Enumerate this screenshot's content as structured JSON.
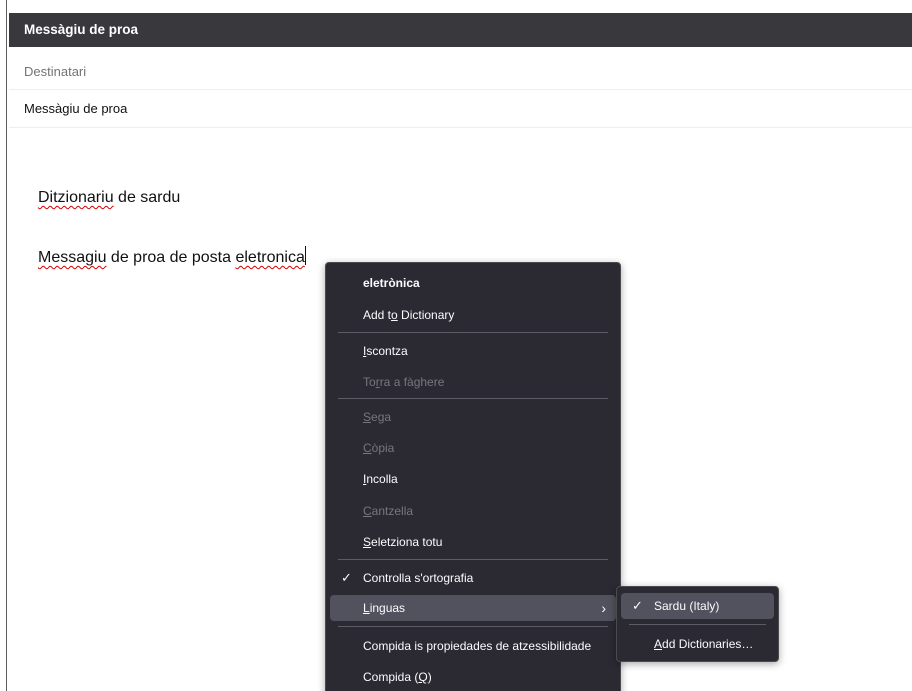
{
  "window": {
    "title": "Messàgiu de proa"
  },
  "compose": {
    "to_placeholder": "Destinatari",
    "subject": "Messàgiu de proa",
    "body": {
      "line1": {
        "word1": "Ditzionariu",
        "rest": " de sardu"
      },
      "line2": {
        "word1": "Messagiu",
        "middle": " de proa de posta ",
        "word2": "eletronica"
      }
    }
  },
  "context_menu": {
    "suggestion": "eletrònica",
    "add_to_dictionary": {
      "pre": "Add t",
      "key": "o",
      "post": " Dictionary"
    },
    "undo": {
      "pre": "",
      "key": "I",
      "post": "scontza"
    },
    "redo": {
      "pre": "To",
      "key": "r",
      "post": "ra a fàghere"
    },
    "cut": {
      "pre": "",
      "key": "S",
      "post": "ega"
    },
    "copy": {
      "pre": "",
      "key": "C",
      "post": "òpia"
    },
    "paste": {
      "pre": "",
      "key": "I",
      "post": "ncolla"
    },
    "delete": {
      "pre": "",
      "key": "C",
      "post": "antzella"
    },
    "select_all": {
      "pre": "",
      "key": "S",
      "post": "eletziona totu"
    },
    "check_spelling": {
      "check": "✓",
      "label": "Controlla s'ortografia"
    },
    "languages": {
      "pre": "",
      "key": "L",
      "post": "inguas",
      "arrow": "›"
    },
    "inspect_accessibility": "Compida is propiedades de atzessibilidade",
    "inspect": {
      "pre": "Compida (",
      "key": "Q",
      "post": ")"
    }
  },
  "languages_submenu": {
    "sardu": {
      "check": "✓",
      "label": "Sardu (Italy)"
    },
    "add_dictionaries": {
      "pre": "",
      "key": "A",
      "post": "dd Dictionaries…"
    }
  }
}
